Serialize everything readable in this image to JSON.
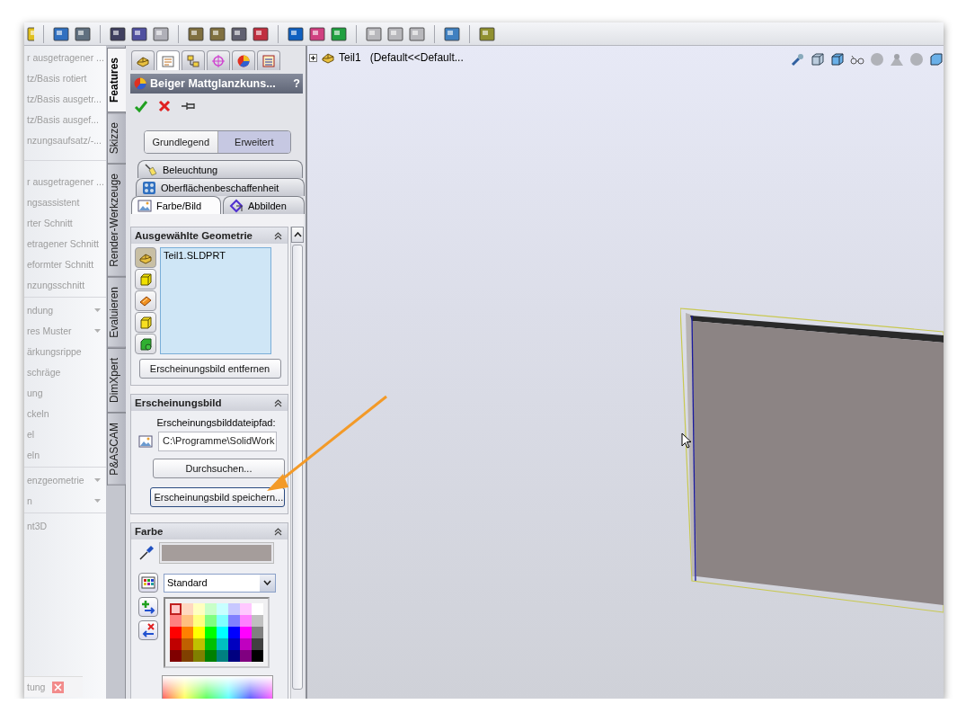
{
  "feature_groups": [
    {
      "items": [
        {
          "label": "r ausgetragener ...",
          "dropdown": false
        },
        {
          "label": "tz/Basis rotiert",
          "dropdown": false
        },
        {
          "label": "tz/Basis ausgetr...",
          "dropdown": false
        },
        {
          "label": "tz/Basis ausgef...",
          "dropdown": false
        },
        {
          "label": "nzungsaufsatz/-...",
          "dropdown": false
        }
      ]
    },
    {
      "items": [
        {
          "label": "r ausgetragener ...",
          "dropdown": false
        },
        {
          "label": "ngsassistent",
          "dropdown": false
        },
        {
          "label": "rter Schnitt",
          "dropdown": false
        },
        {
          "label": "etragener Schnitt",
          "dropdown": false
        },
        {
          "label": "eformter Schnitt",
          "dropdown": false
        },
        {
          "label": "nzungsschnitt",
          "dropdown": false
        }
      ]
    },
    {
      "items": [
        {
          "label": "ndung",
          "dropdown": true
        },
        {
          "label": "res Muster",
          "dropdown": true
        },
        {
          "label": "ärkungsrippe",
          "dropdown": false
        },
        {
          "label": "schräge",
          "dropdown": false
        },
        {
          "label": "ung",
          "dropdown": false
        },
        {
          "label": "ckeln",
          "dropdown": false
        },
        {
          "label": "el",
          "dropdown": false
        },
        {
          "label": "eln",
          "dropdown": false
        }
      ]
    },
    {
      "items": [
        {
          "label": "enzgeometrie",
          "dropdown": true
        },
        {
          "label": "n",
          "dropdown": true
        }
      ]
    },
    {
      "items": [
        {
          "label": "nt3D",
          "dropdown": false
        }
      ]
    }
  ],
  "bottom_tab": {
    "label": "tung"
  },
  "side_tabs": [
    {
      "label": "Features",
      "selected": true
    },
    {
      "label": "Skizze",
      "selected": false
    },
    {
      "label": "Render-Werkzeuge",
      "selected": false
    },
    {
      "label": "Evaluieren",
      "selected": false
    },
    {
      "label": "DimXpert",
      "selected": false
    },
    {
      "label": "P&ASCAM",
      "selected": false
    }
  ],
  "manager_tabs": [
    {
      "kind": "features",
      "selected": false
    },
    {
      "kind": "properties",
      "selected": true
    },
    {
      "kind": "configurations",
      "selected": false
    },
    {
      "kind": "target",
      "selected": false
    },
    {
      "kind": "display",
      "selected": false
    },
    {
      "kind": "cam",
      "selected": false
    }
  ],
  "property_manager": {
    "title": "Beiger Mattglanzkuns...",
    "help": "?",
    "modes": [
      {
        "label": "Grundlegend",
        "selected": false
      },
      {
        "label": "Erweitert",
        "selected": true
      }
    ],
    "tabs": [
      {
        "label": "Beleuchtung",
        "kind": "light",
        "selected": false
      },
      {
        "label": "Oberflächenbeschaffenheit",
        "kind": "surface",
        "selected": false
      },
      {
        "label": "Farbe/Bild",
        "kind": "image",
        "selected": true
      },
      {
        "label": "Abbilden",
        "kind": "mapping",
        "selected": false
      }
    ],
    "geometry": {
      "title": "Ausgewählte Geometrie",
      "expanded": true,
      "filters": [
        {
          "kind": "part",
          "selected": true
        },
        {
          "kind": "face",
          "selected": false
        },
        {
          "kind": "feature",
          "selected": false
        },
        {
          "kind": "body",
          "selected": false
        },
        {
          "kind": "solid",
          "selected": false
        }
      ],
      "items": [
        {
          "label": "Teil1.SLDPRT"
        }
      ],
      "button": "Erscheinungsbild entfernen"
    },
    "appearance": {
      "title": "Erscheinungsbild",
      "expanded": true,
      "path_label": "Erscheinungsbilddateipfad:",
      "path_value": "C:\\Programme\\SolidWork",
      "buttons": [
        "Durchsuchen...",
        "Erscheinungsbild speichern..."
      ]
    },
    "color": {
      "title": "Farbe",
      "expanded": true,
      "palette": "Standard",
      "swatches": [
        {
          "color": "#ffc8c8",
          "selected": true
        },
        {
          "color": "#ffd8c0",
          "selected": false
        },
        {
          "color": "#ffffc0",
          "selected": false
        },
        {
          "color": "#c8ffc8",
          "selected": false
        },
        {
          "color": "#c8ffff",
          "selected": false
        },
        {
          "color": "#c8c8ff",
          "selected": false
        },
        {
          "color": "#ffc8ff",
          "selected": false
        },
        {
          "color": "#ffffff",
          "selected": false
        },
        {
          "color": "#ff8080",
          "selected": false
        },
        {
          "color": "#ffc080",
          "selected": false
        },
        {
          "color": "#ffff80",
          "selected": false
        },
        {
          "color": "#80ff80",
          "selected": false
        },
        {
          "color": "#80ffff",
          "selected": false
        },
        {
          "color": "#8080ff",
          "selected": false
        },
        {
          "color": "#ff80ff",
          "selected": false
        },
        {
          "color": "#c0c0c0",
          "selected": false
        },
        {
          "color": "#ff0000",
          "selected": false
        },
        {
          "color": "#ff8000",
          "selected": false
        },
        {
          "color": "#ffff00",
          "selected": false
        },
        {
          "color": "#00ff00",
          "selected": false
        },
        {
          "color": "#00ffff",
          "selected": false
        },
        {
          "color": "#0000ff",
          "selected": false
        },
        {
          "color": "#ff00ff",
          "selected": false
        },
        {
          "color": "#808080",
          "selected": false
        },
        {
          "color": "#c00000",
          "selected": false
        },
        {
          "color": "#c06000",
          "selected": false
        },
        {
          "color": "#c0c000",
          "selected": false
        },
        {
          "color": "#00c000",
          "selected": false
        },
        {
          "color": "#00c0c0",
          "selected": false
        },
        {
          "color": "#0000c0",
          "selected": false
        },
        {
          "color": "#c000c0",
          "selected": false
        },
        {
          "color": "#404040",
          "selected": false
        },
        {
          "color": "#800000",
          "selected": false
        },
        {
          "color": "#804000",
          "selected": false
        },
        {
          "color": "#808000",
          "selected": false
        },
        {
          "color": "#008000",
          "selected": false
        },
        {
          "color": "#008080",
          "selected": false
        },
        {
          "color": "#000080",
          "selected": false
        },
        {
          "color": "#800080",
          "selected": false
        },
        {
          "color": "#000000",
          "selected": false
        }
      ]
    }
  },
  "viewport": {
    "tree_root": {
      "name": "Teil1",
      "configuration": "(Default<<Default...",
      "expanded": false
    }
  }
}
